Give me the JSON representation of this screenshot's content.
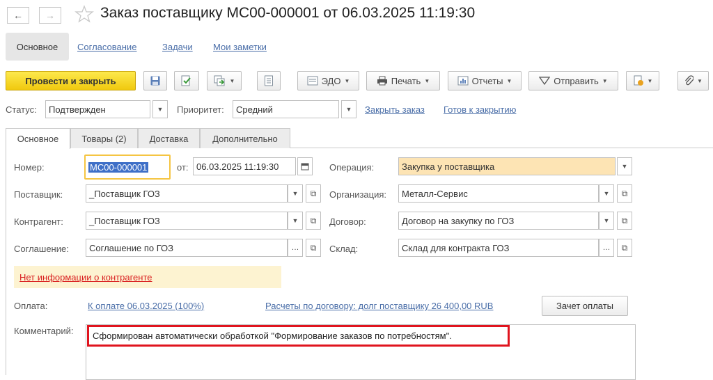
{
  "window": {
    "title": "Заказ поставщику МС00-000001 от 06.03.2025 11:19:30"
  },
  "nav_tabs": [
    "Основное",
    "Согласование",
    "Задачи",
    "Мои заметки"
  ],
  "toolbar": {
    "post_close": "Провести и закрыть",
    "edo": "ЭДО",
    "print": "Печать",
    "reports": "Отчеты",
    "send": "Отправить"
  },
  "status": {
    "status_label": "Статус:",
    "status_value": "Подтвержден",
    "priority_label": "Приоритет:",
    "priority_value": "Средний",
    "close_order_link": "Закрыть заказ",
    "ready_link": "Готов к закрытию"
  },
  "tabs": [
    "Основное",
    "Товары (2)",
    "Доставка",
    "Дополнительно"
  ],
  "form": {
    "number_label": "Номер:",
    "number_value": "МС00-000001",
    "from_label": "от:",
    "date_value": "06.03.2025 11:19:30",
    "operation_label": "Операция:",
    "operation_value": "Закупка у поставщика",
    "supplier_label": "Поставщик:",
    "supplier_value": "_Поставщик ГОЗ",
    "organization_label": "Организация:",
    "organization_value": "Металл-Сервис",
    "counterparty_label": "Контрагент:",
    "counterparty_value": "_Поставщик ГОЗ",
    "contract_label": "Договор:",
    "contract_value": "Договор на закупку по ГОЗ",
    "agreement_label": "Соглашение:",
    "agreement_value": "Соглашение по ГОЗ",
    "warehouse_label": "Склад:",
    "warehouse_value": "Склад для контракта ГОЗ",
    "no_info_link": "Нет информации о контрагенте",
    "payment_label": "Оплата:",
    "payment_link": "К оплате 06.03.2025 (100%)",
    "settlements_link": "Расчеты по договору: долг поставщику 26 400,00 RUB",
    "offset_button": "Зачет оплаты",
    "comment_label": "Комментарий:",
    "comment_value": "Сформирован автоматически обработкой \"Формирование заказов по потребностям\"."
  },
  "colors": {
    "primary_button": "#f6d21f",
    "operation_field": "#fde4b4",
    "warning_bg": "#fdf3d1",
    "warning_text": "#d92020",
    "highlight_border": "#e0141e",
    "link": "#4a6ea8"
  }
}
